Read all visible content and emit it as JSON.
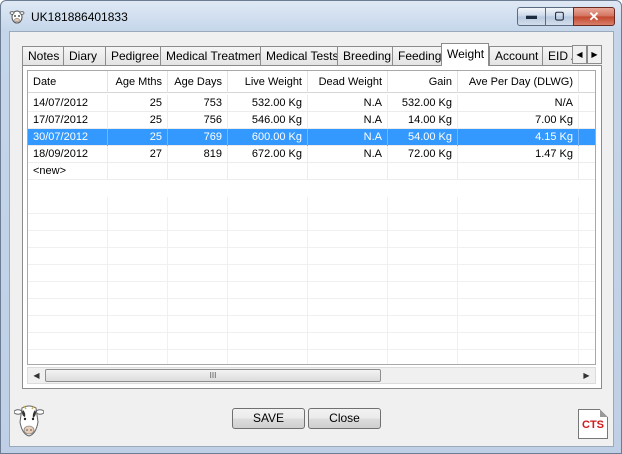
{
  "window": {
    "title": "UK181886401833",
    "minimize_glyph": "▬",
    "maximize_glyph": "▢",
    "close_glyph": "✕"
  },
  "tabs": [
    {
      "label": "Notes",
      "active": false
    },
    {
      "label": "Diary",
      "active": false
    },
    {
      "label": "Pedigree",
      "active": false
    },
    {
      "label": "Medical Treatment",
      "active": false
    },
    {
      "label": "Medical Tests",
      "active": false
    },
    {
      "label": "Breeding",
      "active": false
    },
    {
      "label": "Feeding",
      "active": false
    },
    {
      "label": "Weight",
      "active": true
    },
    {
      "label": "Account",
      "active": false
    },
    {
      "label": "EID /",
      "active": false
    }
  ],
  "grid": {
    "columns": [
      "Date",
      "Age Mths",
      "Age Days",
      "Live Weight",
      "Dead Weight",
      "Gain",
      "Ave Per Day (DLWG)"
    ],
    "rows": [
      {
        "date": "14/07/2012",
        "age_mths": "25",
        "age_days": "753",
        "live_weight": "532.00 Kg",
        "dead_weight": "N.A",
        "gain": "532.00 Kg",
        "ave_per_day": "N/A",
        "selected": false
      },
      {
        "date": "17/07/2012",
        "age_mths": "25",
        "age_days": "756",
        "live_weight": "546.00 Kg",
        "dead_weight": "N.A",
        "gain": "14.00 Kg",
        "ave_per_day": "7.00 Kg",
        "selected": false
      },
      {
        "date": "30/07/2012",
        "age_mths": "25",
        "age_days": "769",
        "live_weight": "600.00 Kg",
        "dead_weight": "N.A",
        "gain": "54.00 Kg",
        "ave_per_day": "4.15 Kg",
        "selected": true
      },
      {
        "date": "18/09/2012",
        "age_mths": "27",
        "age_days": "819",
        "live_weight": "672.00 Kg",
        "dead_weight": "N.A",
        "gain": "72.00 Kg",
        "ave_per_day": "1.47 Kg",
        "selected": false
      }
    ],
    "new_row_label": "<new>",
    "scroll_grip": "III"
  },
  "buttons": {
    "save": "SAVE",
    "close": "Close"
  },
  "logo": {
    "text": "CTS"
  },
  "colors": {
    "selection": "#3399ff",
    "logo_red": "#d11a1a"
  }
}
